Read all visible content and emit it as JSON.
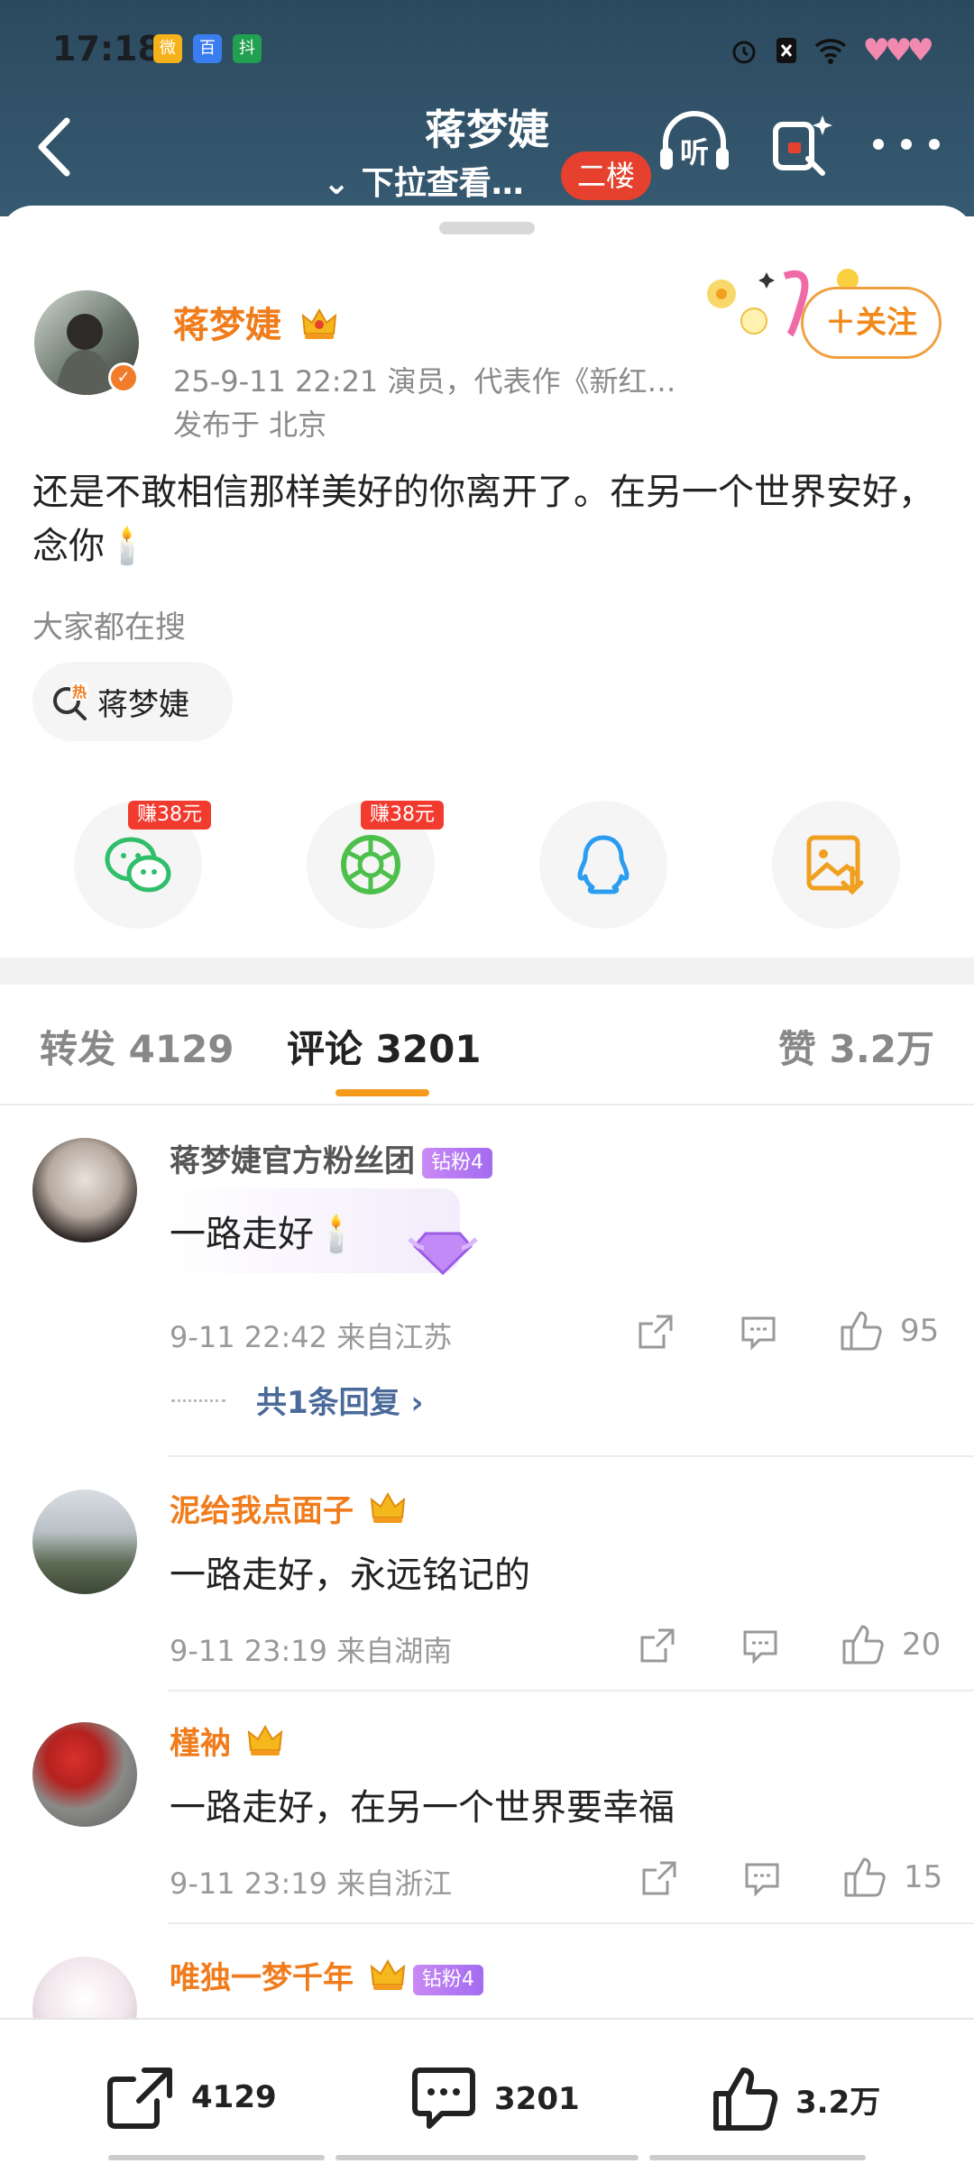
{
  "status_bar": {
    "time": "17:18"
  },
  "nav": {
    "title": "蒋梦婕",
    "subtitle": "⌄ 下拉查看…",
    "floor_badge": "二楼"
  },
  "post": {
    "author": "蒋梦婕",
    "meta": "25-9-11 22:21  演员，代表作《新红…",
    "location": "发布于 北京",
    "follow_label": "＋关注",
    "content": "还是不敢相信那样美好的你离开了。在另一个世界安好，念你🕯️",
    "search_label": "大家都在搜",
    "search_chip": "蒋梦婕",
    "earn_wechat": "赚38元",
    "earn_moments": "赚38元"
  },
  "tabs": {
    "repost": "转发 4129",
    "comments": "评论 3201",
    "likes": "赞 3.2万"
  },
  "comments": [
    {
      "name": "蒋梦婕官方粉丝团",
      "badge": "钻粉4",
      "text": "一路走好🕯️",
      "time": "9-11 22:42  来自江苏",
      "likes": "95",
      "replies": "共1条回复 ›"
    },
    {
      "name": "泥给我点面子",
      "text": "一路走好，永远铭记的",
      "time": "9-11 23:19  来自湖南",
      "likes": "20"
    },
    {
      "name": "槿衲",
      "text": "一路走好，在另一个世界要幸福",
      "time": "9-11 23:19  来自浙江",
      "likes": "15"
    },
    {
      "name": "唯独一梦千年",
      "badge": "钻粉4"
    }
  ],
  "bottom_bar": {
    "repost": "4129",
    "comment": "3201",
    "like": "3.2万"
  }
}
